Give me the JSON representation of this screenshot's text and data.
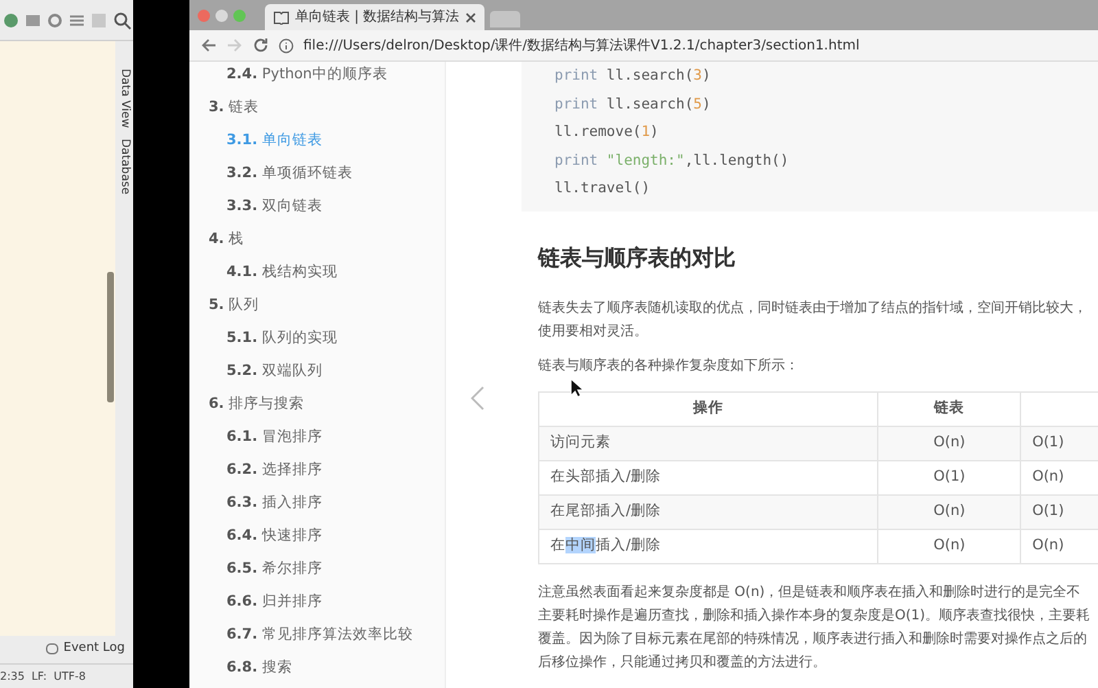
{
  "ide": {
    "side_tabs": [
      "Data View",
      "Database"
    ],
    "event_log": "Event Log",
    "status_bar": [
      "2:35",
      "LF:",
      "UTF-8"
    ]
  },
  "browser": {
    "tab": {
      "title": "单向链表 | 数据结构与算法"
    },
    "address": "file:///Users/delron/Desktop/课件/数据结构与算法课件V1.2.1/chapter3/section1.html"
  },
  "sidebar": {
    "items": [
      {
        "number": "2.4.",
        "title": "Python中的顺序表",
        "selected": false
      },
      {
        "number": "3.",
        "title": "链表",
        "selected": false,
        "children": [
          {
            "number": "3.1.",
            "title": "单向链表",
            "selected": true
          },
          {
            "number": "3.2.",
            "title": "单项循环链表",
            "selected": false
          },
          {
            "number": "3.3.",
            "title": "双向链表",
            "selected": false
          }
        ]
      },
      {
        "number": "4.",
        "title": "栈",
        "selected": false,
        "children": [
          {
            "number": "4.1.",
            "title": "栈结构实现",
            "selected": false
          }
        ]
      },
      {
        "number": "5.",
        "title": "队列",
        "selected": false,
        "children": [
          {
            "number": "5.1.",
            "title": "队列的实现",
            "selected": false
          },
          {
            "number": "5.2.",
            "title": "双端队列",
            "selected": false
          }
        ]
      },
      {
        "number": "6.",
        "title": "排序与搜索",
        "selected": false,
        "children": [
          {
            "number": "6.1.",
            "title": "冒泡排序",
            "selected": false
          },
          {
            "number": "6.2.",
            "title": "选择排序",
            "selected": false
          },
          {
            "number": "6.3.",
            "title": "插入排序",
            "selected": false
          },
          {
            "number": "6.4.",
            "title": "快速排序",
            "selected": false
          },
          {
            "number": "6.5.",
            "title": "希尔排序",
            "selected": false
          },
          {
            "number": "6.6.",
            "title": "归并排序",
            "selected": false
          },
          {
            "number": "6.7.",
            "title": "常见排序算法效率比较",
            "selected": false
          },
          {
            "number": "6.8.",
            "title": "搜索",
            "selected": false
          }
        ]
      }
    ]
  },
  "code": [
    [
      {
        "kind": "keyword",
        "text": "print"
      },
      {
        "kind": "plain",
        "text": " ll.search("
      },
      {
        "kind": "number",
        "text": "3"
      },
      {
        "kind": "plain",
        "text": ")"
      }
    ],
    [
      {
        "kind": "keyword",
        "text": "print"
      },
      {
        "kind": "plain",
        "text": " ll.search("
      },
      {
        "kind": "number",
        "text": "5"
      },
      {
        "kind": "plain",
        "text": ")"
      }
    ],
    [
      {
        "kind": "plain",
        "text": "ll.remove("
      },
      {
        "kind": "number",
        "text": "1"
      },
      {
        "kind": "plain",
        "text": ")"
      }
    ],
    [
      {
        "kind": "keyword",
        "text": "print"
      },
      {
        "kind": "string",
        "text": " \"length:\""
      },
      {
        "kind": "plain",
        "text": ",ll.length()"
      }
    ],
    [
      {
        "kind": "plain",
        "text": "ll.travel()"
      }
    ]
  ],
  "heading": "链表与顺序表的对比",
  "paragraph_1": [
    "链表失去了顺序表随机读取的优点，同时链表由于增加了结点的指针域，空间开销比较大，",
    "使用要相对灵活。"
  ],
  "paragraph_2": "链表与顺序表的各种操作复杂度如下所示：",
  "table": {
    "columns": [
      "操作",
      "链表"
    ],
    "rows": [
      {
        "cells": [
          [
            {
              "text": "访问元素",
              "selected": false
            }
          ],
          "O(n)",
          "O(1)"
        ]
      },
      {
        "cells": [
          [
            {
              "text": "在头部插入/删除",
              "selected": false
            }
          ],
          "O(1)",
          "O(n)"
        ]
      },
      {
        "cells": [
          [
            {
              "text": "在尾部插入/删除",
              "selected": false
            }
          ],
          "O(n)",
          "O(1)"
        ]
      },
      {
        "cells": [
          [
            {
              "text": "在",
              "selected": false
            },
            {
              "text": "中间",
              "selected": true
            },
            {
              "text": "插入/删除",
              "selected": false
            }
          ],
          "O(n)",
          "O(n)"
        ]
      }
    ]
  },
  "paragraph_3": [
    "注意虽然表面看起来复杂度都是 O(n)，但是链表和顺序表在插入和删除时进行的是完全不",
    "主要耗时操作是遍历查找，删除和插入操作本身的复杂度是O(1)。顺序表查找很快，主要耗",
    "覆盖。因为除了目标元素在尾部的特殊情况，顺序表进行插入和删除时需要对操作点之后的",
    "后移位操作，只能通过拷贝和覆盖的方法进行。"
  ]
}
